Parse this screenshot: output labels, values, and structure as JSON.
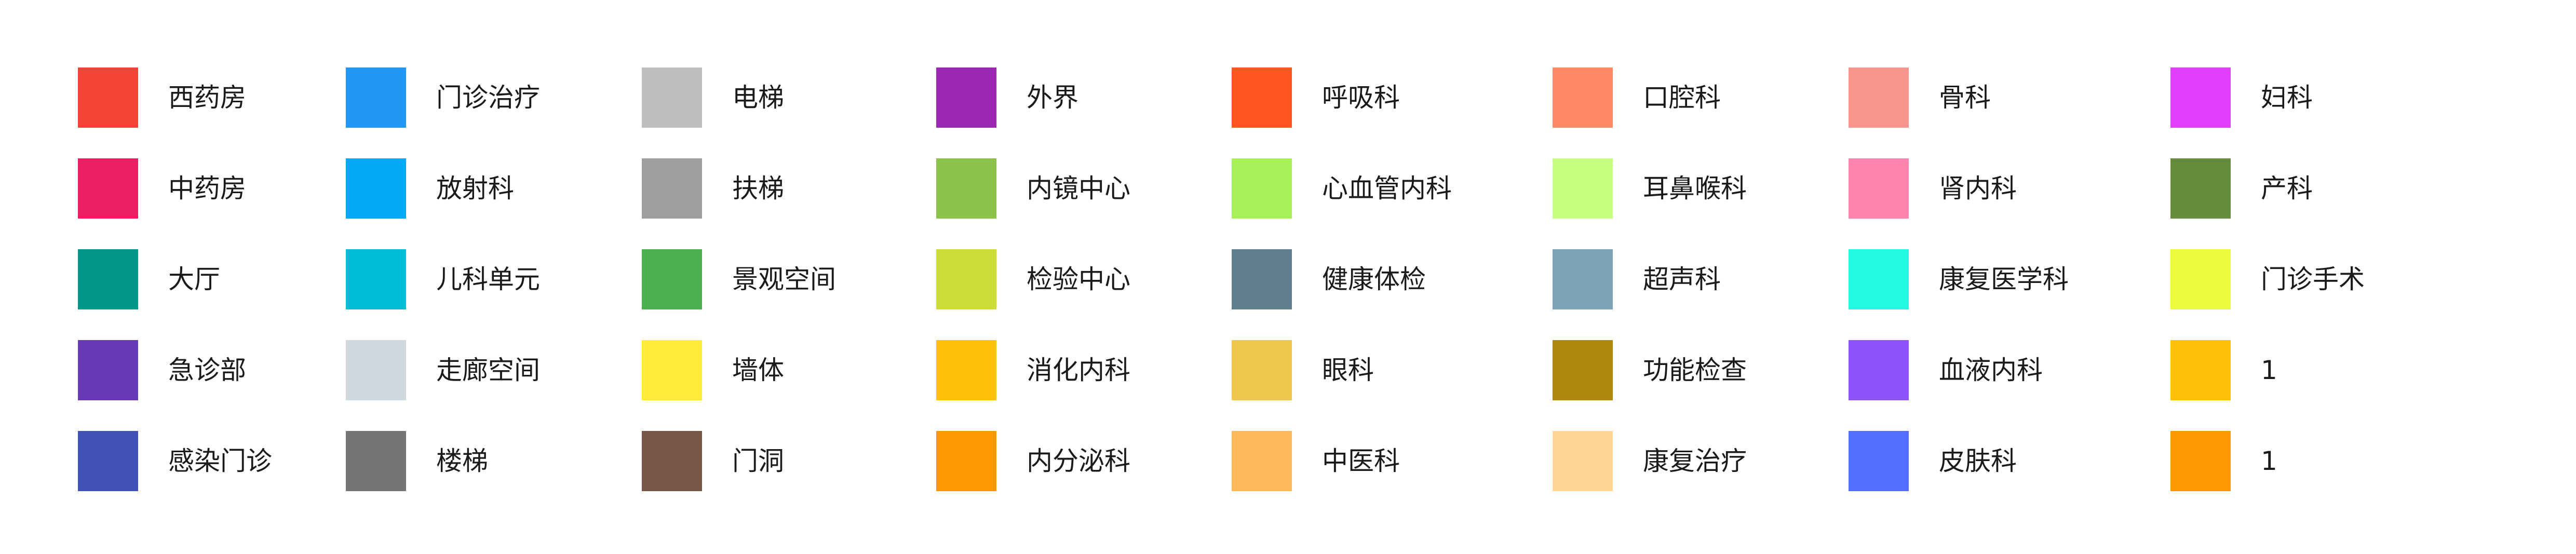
{
  "legend": {
    "columns": [
      {
        "items": [
          {
            "label": "西药房",
            "color": "#F44336"
          },
          {
            "label": "中药房",
            "color": "#E91E63"
          },
          {
            "label": "大厅",
            "color": "#009688"
          },
          {
            "label": "急诊部",
            "color": "#673AB7"
          },
          {
            "label": "感染门诊",
            "color": "#3F51B5"
          }
        ]
      },
      {
        "items": [
          {
            "label": "门诊治疗",
            "color": "#2196F3"
          },
          {
            "label": "放射科",
            "color": "#03A9F4"
          },
          {
            "label": "儿科单元",
            "color": "#00BCD4"
          },
          {
            "label": "走廊空间",
            "color": "#CFD8DC"
          },
          {
            "label": "楼梯",
            "color": "#757575"
          }
        ]
      },
      {
        "items": [
          {
            "label": "电梯",
            "color": "#BDBDBD"
          },
          {
            "label": "扶梯",
            "color": "#9E9E9E"
          },
          {
            "label": "景观空间",
            "color": "#4CAF50"
          },
          {
            "label": "墙体",
            "color": "#FFEB3B"
          },
          {
            "label": "门洞",
            "color": "#795548"
          }
        ]
      },
      {
        "items": [
          {
            "label": "外界",
            "color": "#9C27B0"
          },
          {
            "label": "内镜中心",
            "color": "#8BC34A"
          },
          {
            "label": "检验中心",
            "color": "#CDDC39"
          },
          {
            "label": "消化内科",
            "color": "#FFC107"
          },
          {
            "label": "内分泌科",
            "color": "#FF9800"
          }
        ]
      },
      {
        "items": [
          {
            "label": "呼吸科",
            "color": "#FF5722"
          },
          {
            "label": "心血管内科",
            "color": "#A8EF5C"
          },
          {
            "label": "健康体检",
            "color": "#607D8B"
          },
          {
            "label": "眼科",
            "color": "#EFC74E"
          },
          {
            "label": "中医科",
            "color": "#FFB95B"
          }
        ]
      },
      {
        "items": [
          {
            "label": "口腔科",
            "color": "#FF8A65"
          },
          {
            "label": "耳鼻喉科",
            "color": "#C6FF80"
          },
          {
            "label": "超声科",
            "color": "#7FA3B8"
          },
          {
            "label": "功能检查",
            "color": "#AE870A"
          },
          {
            "label": "康复治疗",
            "color": "#FFD596"
          }
        ]
      },
      {
        "items": [
          {
            "label": "骨科",
            "color": "#F8958E"
          },
          {
            "label": "肾内科",
            "color": "#FF85AE"
          },
          {
            "label": "康复医学科",
            "color": "#22F9E0"
          },
          {
            "label": "血液内科",
            "color": "#8D52F9"
          },
          {
            "label": "皮肤科",
            "color": "#536DFE"
          }
        ]
      },
      {
        "items": [
          {
            "label": "妇科",
            "color": "#E040FB"
          },
          {
            "label": "产科",
            "color": "#668B3C"
          },
          {
            "label": "门诊手术",
            "color": "#EAFB40"
          },
          {
            "label": "1",
            "color": "#FFC107"
          },
          {
            "label": "1",
            "color": "#FF9800"
          }
        ]
      }
    ]
  }
}
